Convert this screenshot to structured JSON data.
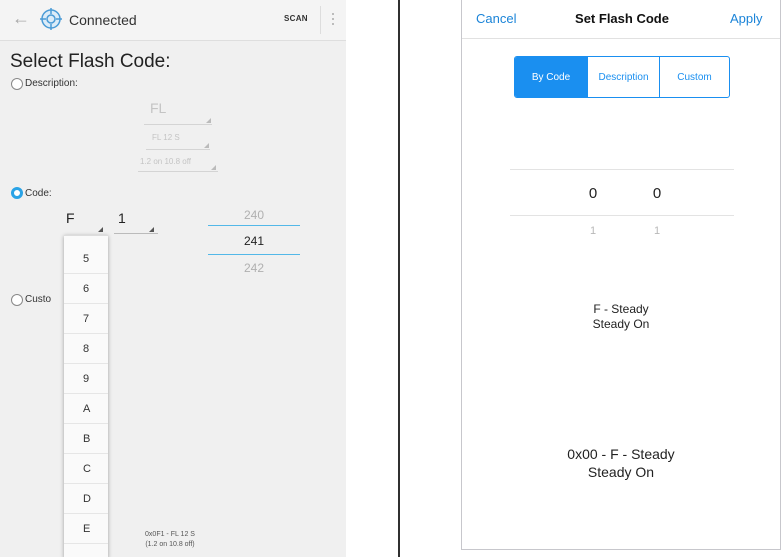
{
  "android": {
    "status": "Connected",
    "scan_label": "SCAN",
    "heading": "Select Flash Code:",
    "description_option": {
      "label": "Description:",
      "values": [
        "FL",
        "FL 12 S",
        "1.2 on 10.8 off"
      ]
    },
    "code_option": {
      "label": "Code:",
      "letter": "F",
      "digit": "1",
      "numbers": [
        "240",
        "241",
        "242"
      ]
    },
    "custom_option_label": "Custo",
    "dropdown_items": [
      "5",
      "6",
      "7",
      "8",
      "9",
      "A",
      "B",
      "C",
      "D",
      "E"
    ],
    "footer": [
      "0x0F1 - FL 12 S",
      "(1.2 on 10.8 off)"
    ],
    "accent_color": "#2aa3e6"
  },
  "ios": {
    "nav": {
      "cancel": "Cancel",
      "title": "Set Flash Code",
      "apply": "Apply"
    },
    "segments": [
      "By Code",
      "Description",
      "Custom"
    ],
    "active_segment": "By Code",
    "picker": {
      "selected": [
        "0",
        "0"
      ],
      "next": [
        "1",
        "1"
      ]
    },
    "summary": [
      "F - Steady",
      "Steady On"
    ],
    "code_summary": [
      "0x00 - F - Steady",
      "Steady On"
    ],
    "accent_color": "#1a8ff0"
  }
}
